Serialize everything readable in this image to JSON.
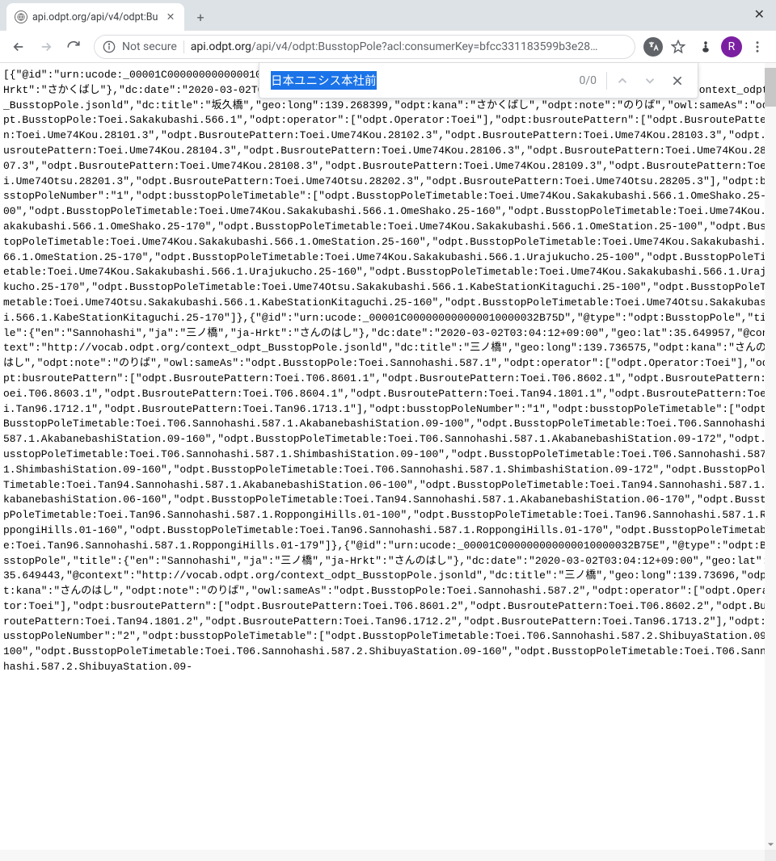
{
  "window": {
    "close_glyph": "✕"
  },
  "tab": {
    "title": "api.odpt.org/api/v4/odpt:Bu",
    "close_glyph": "✕",
    "new_tab_glyph": "+"
  },
  "toolbar": {
    "not_secure": "Not secure",
    "url_host": "api.odpt.org",
    "url_rest": "/api/v4/odpt:BusstopPole?acl:consumerKey=bfcc331183599b3e28…",
    "avatar_letter": "R"
  },
  "find": {
    "query": "日本ユニシス本社前",
    "count": "0/0"
  },
  "content_text": "[{\"@id\":\"urn:ucode:_00001C0000000000000100000                                                                                         Hrkt\":\"さかくばし\"},\"dc:date\":\"2020-03-02T03:04:12+09:00\",\"geo:lat\":35.83173,\"@context\":\"http://vocab.odpt.org/context_odpt_BusstopPole.jsonld\",\"dc:title\":\"坂久橋\",\"geo:long\":139.268399,\"odpt:kana\":\"さかくばし\",\"odpt:note\":\"のりば\",\"owl:sameAs\":\"odpt.BusstopPole:Toei.Sakakubashi.566.1\",\"odpt:operator\":[\"odpt.Operator:Toei\"],\"odpt:busroutePattern\":[\"odpt.BusroutePattern:Toei.Ume74Kou.28101.3\",\"odpt.BusroutePattern:Toei.Ume74Kou.28102.3\",\"odpt.BusroutePattern:Toei.Ume74Kou.28103.3\",\"odpt.BusroutePattern:Toei.Ume74Kou.28104.3\",\"odpt.BusroutePattern:Toei.Ume74Kou.28106.3\",\"odpt.BusroutePattern:Toei.Ume74Kou.28107.3\",\"odpt.BusroutePattern:Toei.Ume74Kou.28108.3\",\"odpt.BusroutePattern:Toei.Ume74Kou.28109.3\",\"odpt.BusroutePattern:Toei.Ume74Otsu.28201.3\",\"odpt.BusroutePattern:Toei.Ume74Otsu.28202.3\",\"odpt.BusroutePattern:Toei.Ume74Otsu.28205.3\"],\"odpt:busstopPoleNumber\":\"1\",\"odpt:busstopPoleTimetable\":[\"odpt.BusstopPoleTimetable:Toei.Ume74Kou.Sakakubashi.566.1.OmeShako.25-100\",\"odpt.BusstopPoleTimetable:Toei.Ume74Kou.Sakakubashi.566.1.OmeShako.25-160\",\"odpt.BusstopPoleTimetable:Toei.Ume74Kou.Sakakubashi.566.1.OmeShako.25-170\",\"odpt.BusstopPoleTimetable:Toei.Ume74Kou.Sakakubashi.566.1.OmeStation.25-100\",\"odpt.BusstopPoleTimetable:Toei.Ume74Kou.Sakakubashi.566.1.OmeStation.25-160\",\"odpt.BusstopPoleTimetable:Toei.Ume74Kou.Sakakubashi.566.1.OmeStation.25-170\",\"odpt.BusstopPoleTimetable:Toei.Ume74Kou.Sakakubashi.566.1.Urajukucho.25-100\",\"odpt.BusstopPoleTimetable:Toei.Ume74Kou.Sakakubashi.566.1.Urajukucho.25-160\",\"odpt.BusstopPoleTimetable:Toei.Ume74Kou.Sakakubashi.566.1.Urajukucho.25-170\",\"odpt.BusstopPoleTimetable:Toei.Ume74Otsu.Sakakubashi.566.1.KabeStationKitaguchi.25-100\",\"odpt.BusstopPoleTimetable:Toei.Ume74Otsu.Sakakubashi.566.1.KabeStationKitaguchi.25-160\",\"odpt.BusstopPoleTimetable:Toei.Ume74Otsu.Sakakubashi.566.1.KabeStationKitaguchi.25-170\"]},{\"@id\":\"urn:ucode:_00001C000000000000010000032B75D\",\"@type\":\"odpt:BusstopPole\",\"title\":{\"en\":\"Sannohashi\",\"ja\":\"三ノ橋\",\"ja-Hrkt\":\"さんのはし\"},\"dc:date\":\"2020-03-02T03:04:12+09:00\",\"geo:lat\":35.649957,\"@context\":\"http://vocab.odpt.org/context_odpt_BusstopPole.jsonld\",\"dc:title\":\"三ノ橋\",\"geo:long\":139.736575,\"odpt:kana\":\"さんのはし\",\"odpt:note\":\"のりば\",\"owl:sameAs\":\"odpt.BusstopPole:Toei.Sannohashi.587.1\",\"odpt:operator\":[\"odpt.Operator:Toei\"],\"odpt:busroutePattern\":[\"odpt.BusroutePattern:Toei.T06.8601.1\",\"odpt.BusroutePattern:Toei.T06.8602.1\",\"odpt.BusroutePattern:Toei.T06.8603.1\",\"odpt.BusroutePattern:Toei.T06.8604.1\",\"odpt.BusroutePattern:Toei.Tan94.1801.1\",\"odpt.BusroutePattern:Toei.Tan96.1712.1\",\"odpt.BusroutePattern:Toei.Tan96.1713.1\"],\"odpt:busstopPoleNumber\":\"1\",\"odpt:busstopPoleTimetable\":[\"odpt.BusstopPoleTimetable:Toei.T06.Sannohashi.587.1.AkabanebashiStation.09-100\",\"odpt.BusstopPoleTimetable:Toei.T06.Sannohashi.587.1.AkabanebashiStation.09-160\",\"odpt.BusstopPoleTimetable:Toei.T06.Sannohashi.587.1.AkabanebashiStation.09-172\",\"odpt.BusstopPoleTimetable:Toei.T06.Sannohashi.587.1.ShimbashiStation.09-100\",\"odpt.BusstopPoleTimetable:Toei.T06.Sannohashi.587.1.ShimbashiStation.09-160\",\"odpt.BusstopPoleTimetable:Toei.T06.Sannohashi.587.1.ShimbashiStation.09-172\",\"odpt.BusstopPoleTimetable:Toei.Tan94.Sannohashi.587.1.AkabanebashiStation.06-100\",\"odpt.BusstopPoleTimetable:Toei.Tan94.Sannohashi.587.1.AkabanebashiStation.06-160\",\"odpt.BusstopPoleTimetable:Toei.Tan94.Sannohashi.587.1.AkabanebashiStation.06-170\",\"odpt.BusstopPoleTimetable:Toei.Tan96.Sannohashi.587.1.RoppongiHills.01-100\",\"odpt.BusstopPoleTimetable:Toei.Tan96.Sannohashi.587.1.RoppongiHills.01-160\",\"odpt.BusstopPoleTimetable:Toei.Tan96.Sannohashi.587.1.RoppongiHills.01-170\",\"odpt.BusstopPoleTimetable:Toei.Tan96.Sannohashi.587.1.RoppongiHills.01-179\"]},{\"@id\":\"urn:ucode:_00001C000000000000010000032B75E\",\"@type\":\"odpt:BusstopPole\",\"title\":{\"en\":\"Sannohashi\",\"ja\":\"三ノ橋\",\"ja-Hrkt\":\"さんのはし\"},\"dc:date\":\"2020-03-02T03:04:12+09:00\",\"geo:lat\":35.649443,\"@context\":\"http://vocab.odpt.org/context_odpt_BusstopPole.jsonld\",\"dc:title\":\"三ノ橋\",\"geo:long\":139.73696,\"odpt:kana\":\"さんのはし\",\"odpt:note\":\"のりば\",\"owl:sameAs\":\"odpt.BusstopPole:Toei.Sannohashi.587.2\",\"odpt:operator\":[\"odpt.Operator:Toei\"],\"odpt:busroutePattern\":[\"odpt.BusroutePattern:Toei.T06.8601.2\",\"odpt.BusroutePattern:Toei.T06.8602.2\",\"odpt.BusroutePattern:Toei.Tan94.1801.2\",\"odpt.BusroutePattern:Toei.Tan96.1712.2\",\"odpt.BusroutePattern:Toei.Tan96.1713.2\"],\"odpt:busstopPoleNumber\":\"2\",\"odpt:busstopPoleTimetable\":[\"odpt.BusstopPoleTimetable:Toei.T06.Sannohashi.587.2.ShibuyaStation.09-100\",\"odpt.BusstopPoleTimetable:Toei.T06.Sannohashi.587.2.ShibuyaStation.09-160\",\"odpt.BusstopPoleTimetable:Toei.T06.Sannohashi.587.2.ShibuyaStation.09-"
}
